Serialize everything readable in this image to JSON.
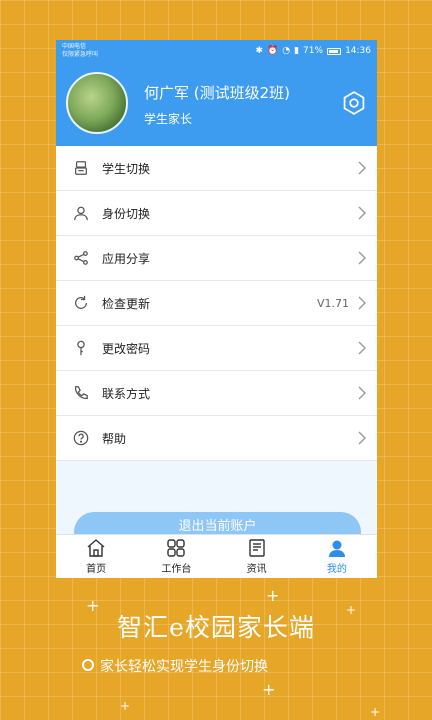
{
  "status": {
    "carrier": "中国电信",
    "emergency": "仅限紧急呼叫",
    "battery": "71%",
    "time": "14:36"
  },
  "profile": {
    "name": "何广军 (测试班级2班)",
    "role": "学生家长"
  },
  "menu": [
    {
      "label": "学生切换",
      "icon": "student-switch-icon"
    },
    {
      "label": "身份切换",
      "icon": "person-icon"
    },
    {
      "label": "应用分享",
      "icon": "share-icon"
    },
    {
      "label": "检查更新",
      "icon": "refresh-icon",
      "value": "V1.71"
    },
    {
      "label": "更改密码",
      "icon": "key-icon"
    },
    {
      "label": "联系方式",
      "icon": "phone-icon"
    },
    {
      "label": "帮助",
      "icon": "help-icon"
    }
  ],
  "logout_label": "退出当前账户",
  "tabs": [
    {
      "label": "首页",
      "icon": "home-icon"
    },
    {
      "label": "工作台",
      "icon": "workbench-icon"
    },
    {
      "label": "资讯",
      "icon": "news-icon"
    },
    {
      "label": "我的",
      "icon": "profile-icon",
      "active": true
    }
  ],
  "promo": {
    "title": "智汇e校园家长端",
    "subtitle": "家长轻松实现学生身份切换"
  },
  "colors": {
    "accent": "#3d9cf0",
    "background": "#e6a628"
  }
}
